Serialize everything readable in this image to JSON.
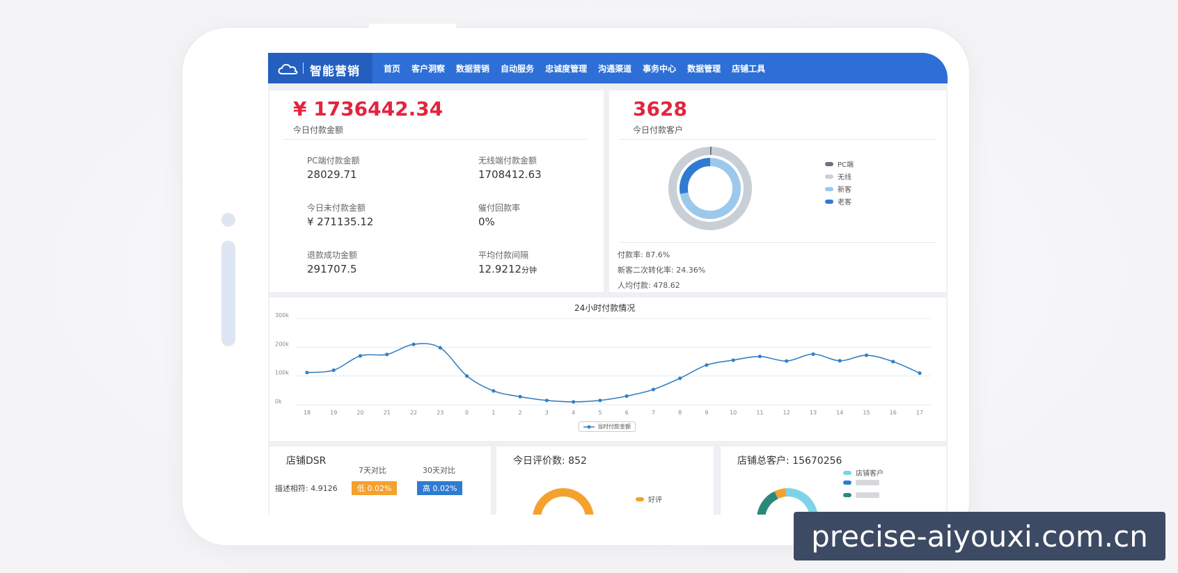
{
  "nav": {
    "brand": "智能营销",
    "items": [
      "首页",
      "客户洞察",
      "数据营销",
      "自动服务",
      "忠诚度管理",
      "沟通渠道",
      "事务中心",
      "数据管理",
      "店铺工具"
    ]
  },
  "payment": {
    "total_value": "¥ 1736442.34",
    "total_label": "今日付款金额",
    "stats": [
      {
        "label": "PC端付款金额",
        "value": "28029.71",
        "unit": ""
      },
      {
        "label": "无线端付款金额",
        "value": "1708412.63",
        "unit": ""
      },
      {
        "label": "今日未付款金额",
        "value": "¥ 271135.12",
        "unit": ""
      },
      {
        "label": "催付回款率",
        "value": "0%",
        "unit": ""
      },
      {
        "label": "退款成功金额",
        "value": "291707.5",
        "unit": ""
      },
      {
        "label": "平均付款间隔",
        "value": "12.9212",
        "unit": "分钟"
      }
    ]
  },
  "customers": {
    "total_value": "3628",
    "total_label": "今日付款客户",
    "legend": [
      {
        "label": "PC端",
        "color": "#6b7280"
      },
      {
        "label": "无线",
        "color": "#c9cfd6"
      },
      {
        "label": "新客",
        "color": "#9cc8ec"
      },
      {
        "label": "老客",
        "color": "#2f7bd2"
      }
    ],
    "donut": {
      "outer": [
        {
          "name": "PC端",
          "value": 0.6,
          "color": "#6b7280"
        },
        {
          "name": "无线",
          "value": 99.4,
          "color": "#c9cfd6"
        }
      ],
      "inner": [
        {
          "name": "新客",
          "value": 72,
          "color": "#9cc8ec"
        },
        {
          "name": "老客",
          "value": 28,
          "color": "#2f7bd2"
        }
      ]
    },
    "stats": [
      "付款率: 87.6%",
      "新客二次转化率: 24.36%",
      "人均付款: 478.62"
    ]
  },
  "chart_data": {
    "type": "line",
    "title": "24小时付款情况",
    "categories": [
      "18",
      "19",
      "20",
      "21",
      "22",
      "23",
      "0",
      "1",
      "2",
      "3",
      "4",
      "5",
      "6",
      "7",
      "8",
      "9",
      "10",
      "11",
      "12",
      "13",
      "14",
      "15",
      "16",
      "17"
    ],
    "series": [
      {
        "name": "当时付款金额",
        "values": [
          112000,
          120000,
          170000,
          175000,
          210000,
          198000,
          100000,
          48000,
          28000,
          15000,
          10000,
          15000,
          30000,
          53000,
          92000,
          138000,
          155000,
          168000,
          152000,
          176000,
          153000,
          172000,
          150000,
          110000
        ],
        "color": "#3580c4"
      }
    ],
    "y_ticks": [
      "0k",
      "100k",
      "200k",
      "300k"
    ],
    "ylim": [
      0,
      300000
    ],
    "grid": true,
    "legend": "bottom"
  },
  "dsr": {
    "title": "店铺DSR",
    "col_7d": "7天对比",
    "col_30d": "30天对比",
    "row_label": "描述相符: 4.9126",
    "badge_7d": "低 0.02%",
    "badge_30d": "高 0.02%",
    "badge_7d_color": "#f4a12e",
    "badge_30d_color": "#2f7bd2"
  },
  "reviews": {
    "title": "今日评价数: 852",
    "legend_label": "好评",
    "color": "#f4a12e"
  },
  "store_customers": {
    "title": "店铺总客户: 15670256",
    "legend": [
      {
        "label": "店铺客户",
        "color": "#7dd3e8"
      },
      {
        "label": "",
        "color": "#2f7bd2"
      },
      {
        "label": "",
        "color": "#2a8a7a"
      }
    ]
  },
  "watermark": "precise-aiyouxi.com.cn"
}
